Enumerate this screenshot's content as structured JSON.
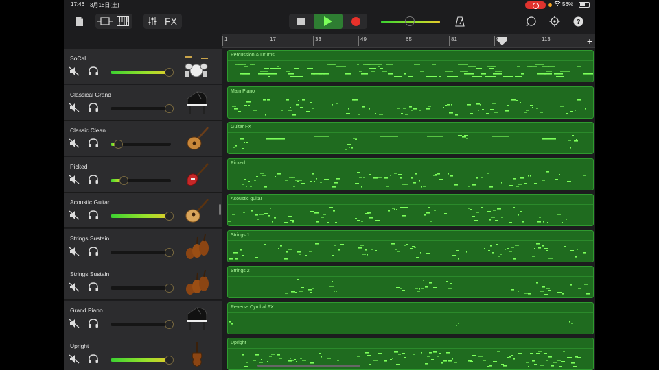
{
  "status_bar": {
    "time": "17:46",
    "date": "3月18日(土)",
    "battery": "56%"
  },
  "toolbar": {
    "fx_label": "FX"
  },
  "ruler": {
    "markers": [
      "1",
      "17",
      "33",
      "49",
      "65",
      "81",
      "97",
      "113"
    ]
  },
  "tracks": [
    {
      "name": "SoCal",
      "instrument_icon": "drum-kit-icon",
      "volume": 1.0,
      "region": "Percussion & Drums"
    },
    {
      "name": "Classical Grand",
      "instrument_icon": "grand-piano-icon",
      "volume": 0.0,
      "region": "Main Piano"
    },
    {
      "name": "Classic Clean",
      "instrument_icon": "electric-guitar-icon",
      "volume": 0.08,
      "region": "Guitar FX"
    },
    {
      "name": "Picked",
      "instrument_icon": "bass-guitar-icon",
      "volume": 0.18,
      "region": "Picked"
    },
    {
      "name": "Acoustic Guitar",
      "instrument_icon": "acoustic-guitar-icon",
      "volume": 1.0,
      "region": "Acoustic guitar"
    },
    {
      "name": "Strings Sustain",
      "instrument_icon": "strings-icon",
      "volume": 0.0,
      "region": "Strings 1"
    },
    {
      "name": "Strings Sustain",
      "instrument_icon": "strings-icon",
      "volume": 0.0,
      "region": "Strings 2"
    },
    {
      "name": "Grand Piano",
      "instrument_icon": "grand-piano-icon",
      "volume": 0.0,
      "region": "Reverse Cymbal FX"
    },
    {
      "name": "Upright",
      "instrument_icon": "upright-bass-icon",
      "volume": 1.0,
      "region": "Upright"
    }
  ],
  "colors": {
    "region_fill": "#1f6b1f",
    "region_border": "#2f9a2f",
    "note": "#7cff5a",
    "record": "#e8312a"
  }
}
